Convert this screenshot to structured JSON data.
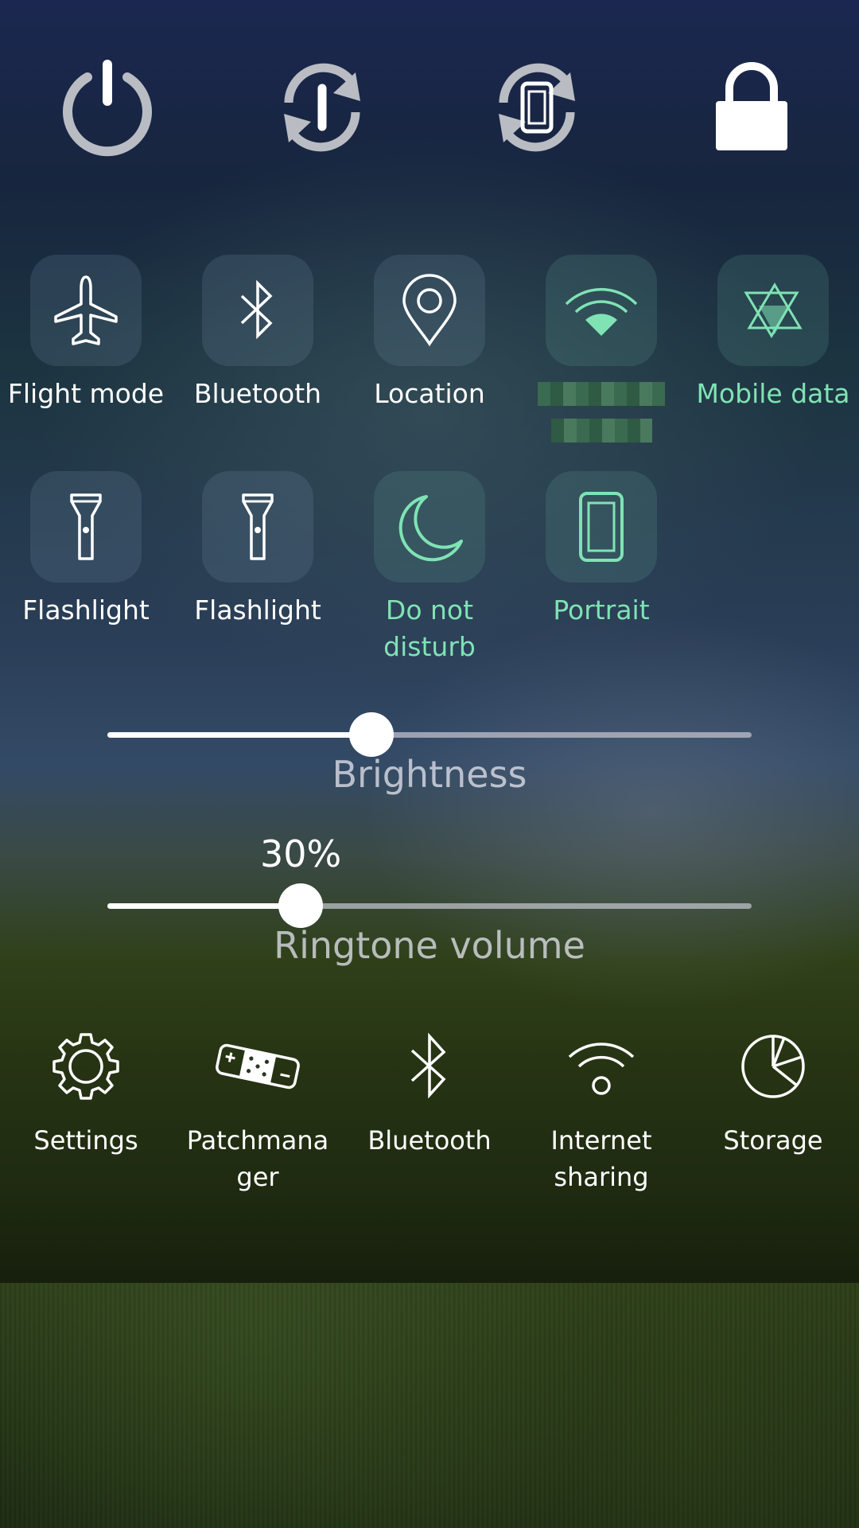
{
  "power_actions": [
    {
      "name": "power-off",
      "icon": "power-icon"
    },
    {
      "name": "reboot",
      "icon": "reboot-icon"
    },
    {
      "name": "restart-ui",
      "icon": "restart-phone-icon"
    },
    {
      "name": "lock",
      "icon": "lock-icon"
    }
  ],
  "quick_toggles": [
    {
      "label": "Flight mode",
      "icon": "airplane-icon",
      "active": false
    },
    {
      "label": "Bluetooth",
      "icon": "bluetooth-icon",
      "active": false
    },
    {
      "label": "Location",
      "icon": "location-pin-icon",
      "active": false
    },
    {
      "label": "",
      "icon": "wifi-icon",
      "active": true,
      "label_redacted": true
    },
    {
      "label": "Mobile data",
      "icon": "mobile-data-icon",
      "active": true
    },
    {
      "label": "Flashlight",
      "icon": "flashlight-icon",
      "active": false
    },
    {
      "label": "Flashlight",
      "icon": "flashlight-icon",
      "active": false
    },
    {
      "label": "Do not disturb",
      "icon": "moon-icon",
      "active": true
    },
    {
      "label": "Portrait",
      "icon": "portrait-orientation-icon",
      "active": true
    }
  ],
  "brightness": {
    "label": "Brightness",
    "level": 0.41
  },
  "ringtone": {
    "label": "Ringtone volume",
    "value_text": "30%",
    "level": 0.3
  },
  "shortcuts": [
    {
      "label": "Settings",
      "icon": "gear-icon"
    },
    {
      "label": "Patchmanager",
      "icon": "bandage-icon"
    },
    {
      "label": "Bluetooth",
      "icon": "bluetooth-icon"
    },
    {
      "label": "Internet sharing",
      "icon": "hotspot-icon"
    },
    {
      "label": "Storage",
      "icon": "pie-chart-icon"
    }
  ],
  "colors": {
    "active_accent": "#7fe3b4",
    "icon_inactive": "#b9bdc3",
    "text": "#ffffff"
  }
}
